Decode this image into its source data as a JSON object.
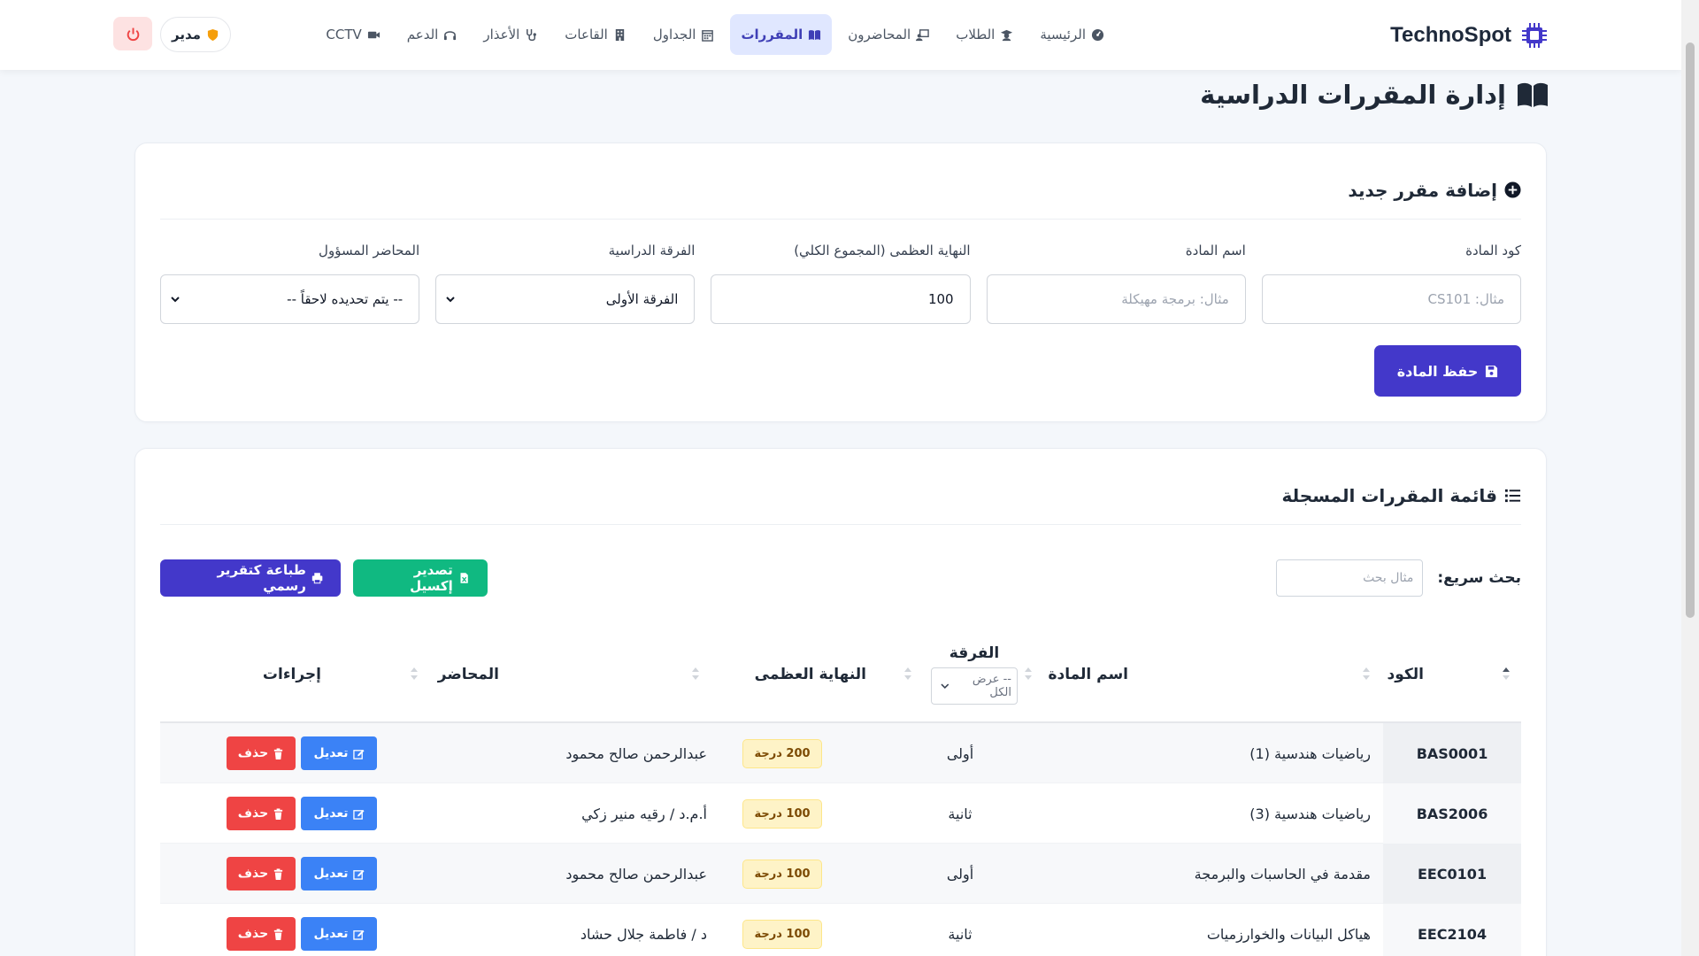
{
  "brand": {
    "name": "TechnoSpot"
  },
  "nav": {
    "items": [
      {
        "label": "الرئيسية",
        "icon": "dashboard-icon",
        "active": false
      },
      {
        "label": "الطلاب",
        "icon": "graduate-icon",
        "active": false
      },
      {
        "label": "المحاضرون",
        "icon": "teacher-icon",
        "active": false
      },
      {
        "label": "المقررات",
        "icon": "book-icon",
        "active": true
      },
      {
        "label": "الجداول",
        "icon": "calendar-icon",
        "active": false
      },
      {
        "label": "القاعات",
        "icon": "building-icon",
        "active": false
      },
      {
        "label": "الأعذار",
        "icon": "stethoscope-icon",
        "active": false
      },
      {
        "label": "الدعم",
        "icon": "headset-icon",
        "active": false
      },
      {
        "label": "CCTV",
        "icon": "video-icon",
        "active": false
      }
    ]
  },
  "user": {
    "role": "مدير"
  },
  "page": {
    "title": "إدارة المقررات الدراسية"
  },
  "add_form": {
    "header": "إضافة مقرر جديد",
    "code_label": "كود المادة",
    "code_placeholder": "مثال: CS101",
    "name_label": "اسم المادة",
    "name_placeholder": "مثال: برمجة مهيكلة",
    "max_label": "النهاية العظمى (المجموع الكلي)",
    "max_value": "100",
    "level_label": "الفرقة الدراسية",
    "level_value": "الفرقة الأولى",
    "lecturer_label": "المحاضر المسؤول",
    "lecturer_value": "-- يتم تحديده لاحقاً --",
    "save_label": "حفظ المادة"
  },
  "list": {
    "header": "قائمة المقررات المسجلة",
    "search_label": "بحث سريع:",
    "search_placeholder": "مثال بحث",
    "excel_label": "تصدير إكسيل",
    "print_label": "طباعة كتقرير رسمي",
    "columns": {
      "code": "الكود",
      "name": "اسم المادة",
      "level": "الفرقة",
      "level_filter": "-- عرض الكل",
      "max": "النهاية العظمى",
      "lecturer": "المحاضر",
      "actions": "إجراءات"
    },
    "edit_label": "تعديل",
    "delete_label": "حذف",
    "rows": [
      {
        "code": "BAS0001",
        "name": "رياضيات هندسية (1)",
        "level": "أولى",
        "max": "200 درجة",
        "lecturer": "عبدالرحمن صالح محمود"
      },
      {
        "code": "BAS2006",
        "name": "رياضيات هندسية (3)",
        "level": "ثانية",
        "max": "100 درجة",
        "lecturer": "أ.م.د / رقيه منير زكي"
      },
      {
        "code": "EEC0101",
        "name": "مقدمة في الحاسبات والبرمجة",
        "level": "أولى",
        "max": "100 درجة",
        "lecturer": "عبدالرحمن صالح محمود"
      },
      {
        "code": "EEC2104",
        "name": "هياكل البيانات والخوارزميات",
        "level": "ثانية",
        "max": "100 درجة",
        "lecturer": "د / فاطمة جلال حشاد"
      }
    ]
  },
  "colors": {
    "primary": "#4338ca",
    "success": "#10b981",
    "edit": "#3b82f6",
    "danger": "#ef4444",
    "badge_bg": "#fef3c7"
  }
}
